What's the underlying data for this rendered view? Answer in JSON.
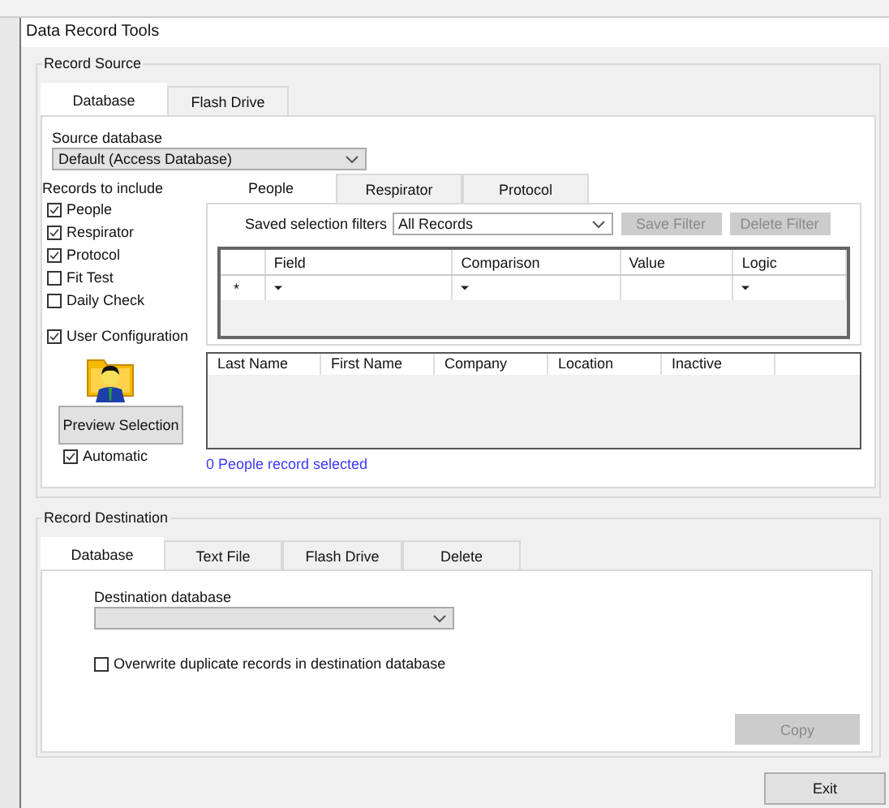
{
  "window": {
    "title": "Data Record Tools"
  },
  "record_source": {
    "label": "Record Source",
    "tabs": [
      {
        "label": "Database",
        "selected": true
      },
      {
        "label": "Flash Drive",
        "selected": false
      }
    ],
    "source_database": {
      "label": "Source database",
      "value": "Default (Access Database)"
    },
    "records_to_include": {
      "label": "Records to include",
      "items": [
        {
          "label": "People",
          "checked": true
        },
        {
          "label": "Respirator",
          "checked": true
        },
        {
          "label": "Protocol",
          "checked": true
        },
        {
          "label": "Fit Test",
          "checked": false
        },
        {
          "label": "Daily Check",
          "checked": false
        }
      ]
    },
    "user_configuration": {
      "label": "User Configuration",
      "checked": true
    },
    "preview_button": {
      "label": "Preview Selection"
    },
    "automatic": {
      "label": "Automatic",
      "checked": true
    },
    "inner_tabs": [
      {
        "label": "People",
        "selected": true
      },
      {
        "label": "Respirator",
        "selected": false
      },
      {
        "label": "Protocol",
        "selected": false
      }
    ],
    "saved_filters": {
      "label": "Saved selection filters",
      "value": "All Records"
    },
    "filter_buttons": [
      {
        "label": "Save Filter",
        "disabled": true
      },
      {
        "label": "Delete Filter",
        "disabled": true
      }
    ],
    "filter_grid": {
      "columns": [
        {
          "label": "Field",
          "dropdown": true
        },
        {
          "label": "Comparison",
          "dropdown": true
        },
        {
          "label": "Value",
          "dropdown": false
        },
        {
          "label": "Logic",
          "dropdown": true
        }
      ],
      "new_row_marker": "*"
    },
    "results": {
      "columns": [
        "Last Name",
        "First Name",
        "Company",
        "Location",
        "Inactive"
      ]
    },
    "status": "0 People record selected"
  },
  "record_destination": {
    "label": "Record Destination",
    "tabs": [
      {
        "label": "Database",
        "selected": true
      },
      {
        "label": "Text File",
        "selected": false
      },
      {
        "label": "Flash Drive",
        "selected": false
      },
      {
        "label": "Delete",
        "selected": false
      }
    ],
    "destination_database": {
      "label": "Destination database"
    },
    "overwrite": {
      "label": "Overwrite duplicate records in destination database",
      "checked": false
    },
    "copy_button": {
      "label": "Copy",
      "disabled": true
    }
  },
  "exit_button": {
    "label": "Exit"
  }
}
